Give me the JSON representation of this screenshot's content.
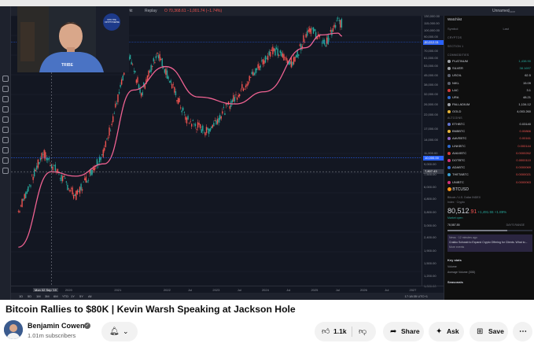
{
  "video": {
    "toolbar": {
      "interval_label": "Markt",
      "replay_label": "Replay",
      "price_readout": "O 70,368.61 −1,001.74 (−1.74%)",
      "layout_name": "Unnamed",
      "layout_status": "Save",
      "currency": "USD"
    },
    "price_axis": {
      "ticks": [
        "130,000.00",
        "115,000.00",
        "100,000.00",
        "90,000.00",
        "80,000.00",
        "70,000.00",
        "61,000.00",
        "53,000.00",
        "45,000.00",
        "38,000.00",
        "32,000.00",
        "26,500.00",
        "22,000.00",
        "17,000.00",
        "14,000.00",
        "11,000.00",
        "9,000.00",
        "7,500.00",
        "6,000.00",
        "4,800.00",
        "3,800.00",
        "3,000.00",
        "2,400.00",
        "1,900.00",
        "1,500.00",
        "1,200.00",
        "1,000.00"
      ],
      "current_tag": "80,512.91",
      "level_tag": "10,000.00",
      "crosshair_tag": "7,807.43"
    },
    "time_axis": {
      "ticks": [
        "2019",
        "2020",
        "2021",
        "2022",
        "Jul",
        "2023",
        "Jul",
        "2024",
        "Jul",
        "2025",
        "Jul",
        "2026",
        "Jul",
        "2027"
      ],
      "crosshair_label": "Mon 02 Sep '19"
    },
    "bottom_bar": {
      "ranges": [
        "1D",
        "5D",
        "1M",
        "3M",
        "6M",
        "YTD",
        "1Y",
        "5Y",
        "All"
      ],
      "clock": "17:18:35 UTC+1"
    },
    "chart_data": {
      "type": "line",
      "title": "BTCUSD",
      "series": [
        {
          "name": "",
          "x": [
            "2019",
            "2019 Jul",
            "2020 Mar",
            "2020 Oct",
            "2021 Apr",
            "2021 Jul",
            "2021 Nov",
            "2022 Jun",
            "2022 Nov",
            "2023 Jun",
            "2024 Mar",
            "2024 Aug",
            "2024 Dec",
            "2025 Apr",
            "2025 Jul",
            "2025 Aug"
          ],
          "values": [
            3800,
            11000,
            5000,
            11500,
            63000,
            32000,
            68000,
            20000,
            16000,
            30000,
            71000,
            55000,
            105000,
            78000,
            118000,
            112000
          ]
        },
        {
          "name": "",
          "x": [
            "2019",
            "2019 Sep",
            "2020 Mar",
            "2020 Oct",
            "2021 May",
            "2022 Jan",
            "2022 Sep",
            "2023 Jun",
            "2024 Jan",
            "2024 Nov",
            "2025 Mar",
            "2025 Jul",
            "2025 Aug"
          ],
          "values": [
            2000,
            7800,
            7200,
            9000,
            34000,
            52000,
            30000,
            26500,
            33000,
            73000,
            92000,
            95000,
            90000
          ]
        }
      ],
      "scale": "log",
      "ylim": [
        1000,
        130000
      ]
    },
    "watchlist": {
      "title": "Watchlist",
      "columns": [
        "Symbol",
        "Last"
      ],
      "sections": [
        "CRYPTOS",
        "SECTION 1",
        "COMMODITIES",
        "ALTCOINS"
      ],
      "commodities": [
        {
          "sym": "PLATINUM",
          "val": "1,438.90",
          "color": "#9fa3a8"
        },
        {
          "sym": "SILVER",
          "val": "38.1697",
          "color": "#9fa3a8"
        },
        {
          "sym": "USOIL",
          "val": "62.5",
          "color": "#5c6270"
        },
        {
          "sym": "NIKL",
          "val": "15.09",
          "color": "#5c6270"
        },
        {
          "sym": "LAC",
          "val": "3.1",
          "color": "#d03b3b"
        },
        {
          "sym": "URA",
          "val": "48.21",
          "color": "#2e6ad1"
        },
        {
          "sym": "PALLADIUM",
          "val": "1,134.12",
          "color": "#9fa3a8"
        },
        {
          "sym": "GOLD",
          "val": "4,003.260",
          "color": "#e7b53a"
        }
      ],
      "alts": [
        {
          "sym": "ETHBTC",
          "val": "0.03140",
          "color": "#6274d1"
        },
        {
          "sym": "BNBBTC",
          "val": "0.00866",
          "color": "#e7b53a"
        },
        {
          "sym": "AAVEBTC",
          "val": "0.00161",
          "color": "#8c64c8"
        },
        {
          "sym": "LINKBTC",
          "val": "0.000144",
          "color": "#2e6ad1"
        },
        {
          "sym": "AVAXBTC",
          "val": "0.0000262",
          "color": "#d03b3b"
        },
        {
          "sym": "DOTBTC",
          "val": "0.0000110",
          "color": "#d0307a"
        },
        {
          "sym": "ADABTC",
          "val": "0.0000069",
          "color": "#2e6ad1"
        },
        {
          "sym": "THETABTC",
          "val": "0.0000021",
          "color": "#3aa0d1"
        },
        {
          "sym": "UNIBTC",
          "val": "0.0000063",
          "color": "#d0307a"
        }
      ],
      "detail": {
        "symbol": "BTCUSD",
        "name": "Bitcoin / U.S. Dollar",
        "exchange": "INDEX",
        "type": "Index · Crypto",
        "price_main": "80,512",
        "price_frac": ".91",
        "change": "+1,491.55 +1.89%",
        "market_label": "Market open",
        "range_low": "78,587.85",
        "range_label": "DAY'S RANGE",
        "news_time": "News · 12 minutes ago",
        "news_text": "Crakko Schwab to Expand Crypto Offering for Clients. What to...",
        "news_more": "More events",
        "key_stats": "Key stats",
        "volume_label": "Volume",
        "avg_volume_label": "Average Volume (30D)",
        "seasonals": "Seasonals"
      }
    },
    "webcam": {
      "shirt_text": "TRIBE",
      "logo_text": "INTO THE CRYPTOVERSE"
    }
  },
  "info": {
    "title": "Bitcoin Rallies to $80K | Kevin Warsh Speaking at Jackson Hole",
    "channel": "Benjamin Cowen",
    "subscribers": "1.01m subscribers",
    "like_count": "1.1k",
    "share_label": "Share",
    "ask_label": "Ask",
    "save_label": "Save"
  },
  "colors": {
    "chart_bg": "#131722",
    "up": "#26a69a",
    "down": "#ef5350",
    "ma": "#f06292",
    "current": "#2962ff"
  }
}
